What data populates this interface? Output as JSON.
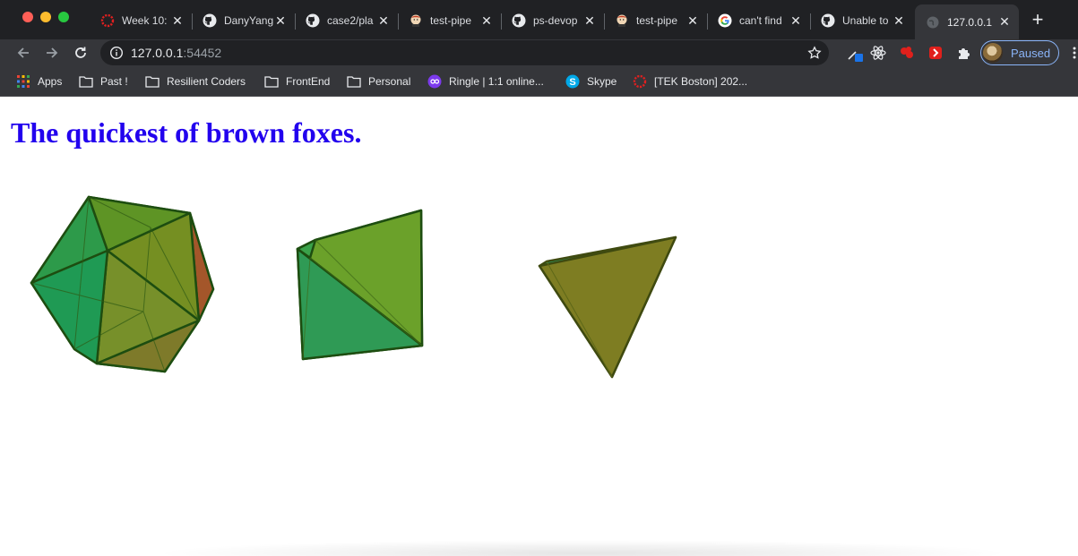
{
  "browser": {
    "tabs": [
      {
        "title": "Week 10:",
        "icon": "ring-logo-icon",
        "active": false
      },
      {
        "title": "DanyYang",
        "icon": "github-icon",
        "active": false
      },
      {
        "title": "case2/pla",
        "icon": "github-icon",
        "active": false
      },
      {
        "title": "test-pipe",
        "icon": "jenkins-icon",
        "active": false
      },
      {
        "title": "ps-devop",
        "icon": "github-icon",
        "active": false
      },
      {
        "title": "test-pipe",
        "icon": "jenkins-icon",
        "active": false
      },
      {
        "title": "can't find",
        "icon": "google-icon",
        "active": false
      },
      {
        "title": "Unable to",
        "icon": "github-icon",
        "active": false
      },
      {
        "title": "127.0.0.1",
        "icon": "globe-icon",
        "active": true
      }
    ],
    "url_host": "127.0.0.1",
    "url_port": ":54452",
    "profile_label": "Paused",
    "bookmarks": [
      {
        "label": "Apps",
        "icon": "apps-grid-icon"
      },
      {
        "label": "Past !",
        "icon": "folder-icon"
      },
      {
        "label": "Resilient Coders",
        "icon": "folder-icon"
      },
      {
        "label": "FrontEnd",
        "icon": "folder-icon"
      },
      {
        "label": "Personal",
        "icon": "folder-icon"
      },
      {
        "label": "Ringle | 1:1 online...",
        "icon": "ringle-icon"
      },
      {
        "label": "Skype",
        "icon": "skype-icon"
      },
      {
        "label": "[TEK Boston] 202...",
        "icon": "ring-logo-icon"
      }
    ]
  },
  "page": {
    "heading": "The quickest of brown foxes.",
    "heading_color": "#2200ee",
    "shapes": [
      "icosahedron",
      "octahedron",
      "tetrahedron"
    ]
  }
}
